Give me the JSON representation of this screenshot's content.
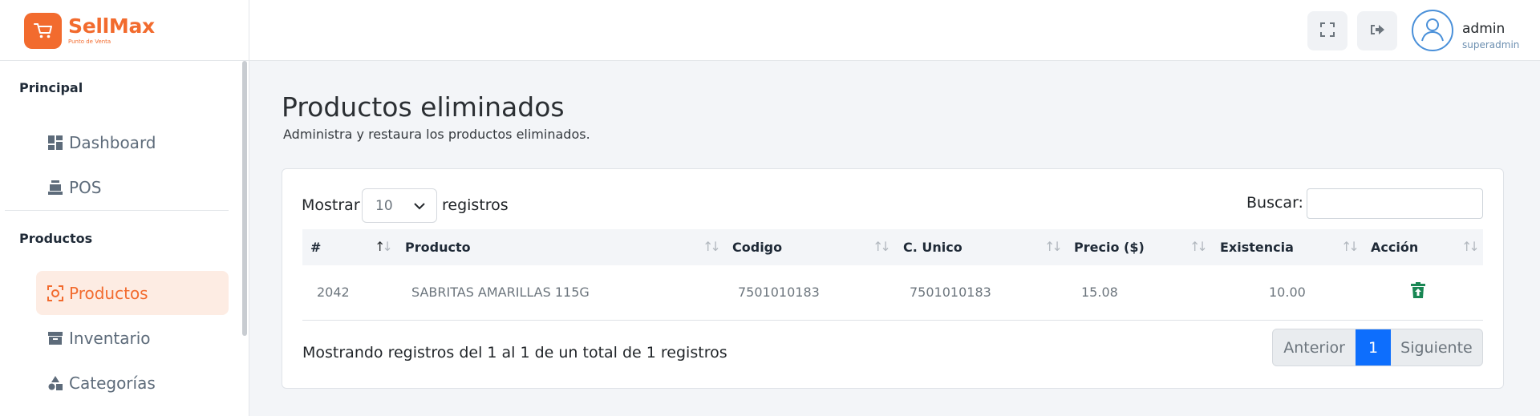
{
  "header": {
    "brand_name": "SellMax",
    "brand_tagline": "Punto de Venta",
    "user_name": "admin",
    "user_role": "superadmin",
    "icons": [
      "cart-icon",
      "fullscreen-icon",
      "logout-icon",
      "user-icon"
    ],
    "accent_color": "#f26b2e"
  },
  "sidebar": {
    "sections": [
      {
        "title": "Principal",
        "items": [
          {
            "label": "Dashboard",
            "icon": "dashboard-icon"
          },
          {
            "label": "POS",
            "icon": "cash-register-icon"
          }
        ]
      },
      {
        "title": "Productos",
        "items": [
          {
            "label": "Productos",
            "icon": "product-icon",
            "active": true
          },
          {
            "label": "Inventario",
            "icon": "archive-icon"
          },
          {
            "label": "Categorías",
            "icon": "shapes-icon"
          }
        ]
      }
    ]
  },
  "main": {
    "title": "Productos eliminados",
    "subtitle": "Administra y restaura los productos eliminados.",
    "show_label": "Mostrar",
    "page_size": "10",
    "records_label": "registros",
    "search_label": "Buscar:",
    "search_value": "",
    "table": {
      "columns": [
        "#",
        "Producto",
        "Codigo",
        "C. Unico",
        "Precio ($)",
        "Existencia",
        "Acción"
      ],
      "rows": [
        {
          "id": "2042",
          "producto": "SABRITAS AMARILLAS 115G",
          "codigo": "7501010183",
          "c_unico": "7501010183",
          "precio": "15.08",
          "existencia": "10.00",
          "action_icon": "restore-icon"
        }
      ]
    },
    "info": "Mostrando registros del 1 al 1 de un total de 1 registros",
    "pagination": {
      "prev": "Anterior",
      "current": "1",
      "next": "Siguiente"
    }
  }
}
